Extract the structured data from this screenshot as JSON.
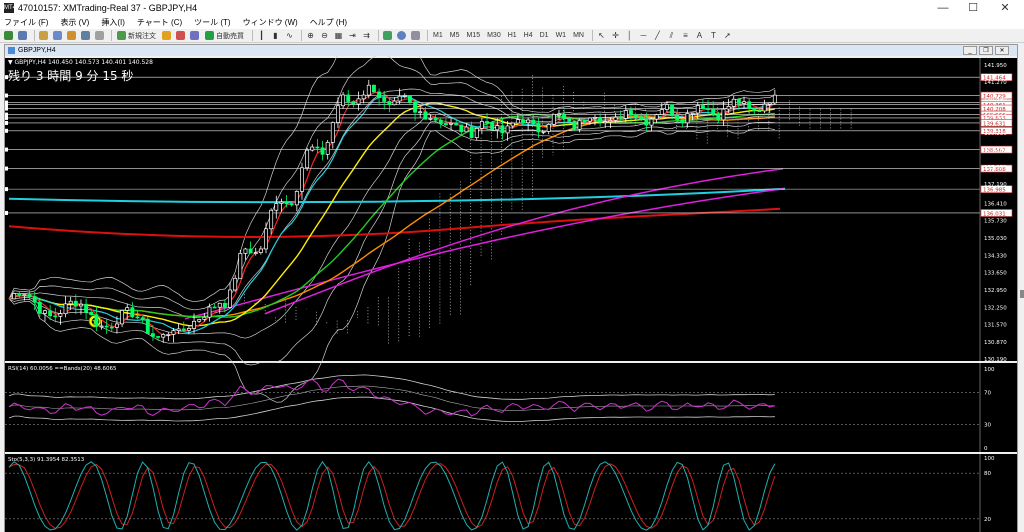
{
  "titlebar": {
    "title": "47010157: XMTrading-Real 37 - GBPJPY,H4",
    "app_icon": "MT4",
    "minimize": "—",
    "maximize": "☐",
    "close": "✕"
  },
  "menu": [
    "ファイル (F)",
    "表示 (V)",
    "挿入(I)",
    "チャート (C)",
    "ツール (T)",
    "ウィンドウ (W)",
    "ヘルプ (H)"
  ],
  "toolbar": {
    "new_order": "新規注文",
    "autotrade": "自動売買",
    "timeframes": [
      "M1",
      "M5",
      "M15",
      "M30",
      "H1",
      "H4",
      "D1",
      "W1",
      "MN"
    ]
  },
  "window": {
    "tab": "GBPJPY,H4"
  },
  "chart": {
    "header": "▼ GBPJPY,H4  140.450 140.573 140.401 140.528",
    "countdown": "残り 3 時間 9 分 15 秒",
    "price_ticks": [
      "141.950",
      "141.270",
      "140.590",
      "139.910",
      "139.230",
      "138.550",
      "137.870",
      "137.190",
      "136.410",
      "135.730",
      "135.030",
      "134.330",
      "133.650",
      "132.950",
      "132.250",
      "131.570",
      "130.870",
      "130.190"
    ],
    "level_labels": [
      "141.464",
      "140.729",
      "140.448",
      "140.361",
      "140.208",
      "139.966",
      "139.833",
      "139.631",
      "139.318",
      "138.567",
      "137.808",
      "136.985",
      "136.031"
    ],
    "current_price": "140.528",
    "rsi_header": "RSI(14) 60.0056  ==Bands(20) 48.6065",
    "rsi_ticks": [
      "100",
      "70",
      "30",
      "0"
    ],
    "stoch_header": "Sto(5,3,3) 91.3954 82.3513",
    "stoch_ticks": [
      "100",
      "80",
      "20"
    ],
    "colors": {
      "background": "#000000",
      "candle_up": "#ffffff",
      "candle_down": "#00ff66",
      "ma_fast": "#ff2020",
      "ma_yellow": "#ffee00",
      "ma_orange": "#ff8c00",
      "ma_green": "#22cc22",
      "ma_cyan": "#20d0e0",
      "ma_red_long": "#dd1010",
      "ma_magenta": "#e020e0",
      "bands": "#d0d0d0",
      "rsi": "#cc33cc",
      "stoch_main": "#20b0b0",
      "stoch_signal": "#cc2020"
    }
  }
}
